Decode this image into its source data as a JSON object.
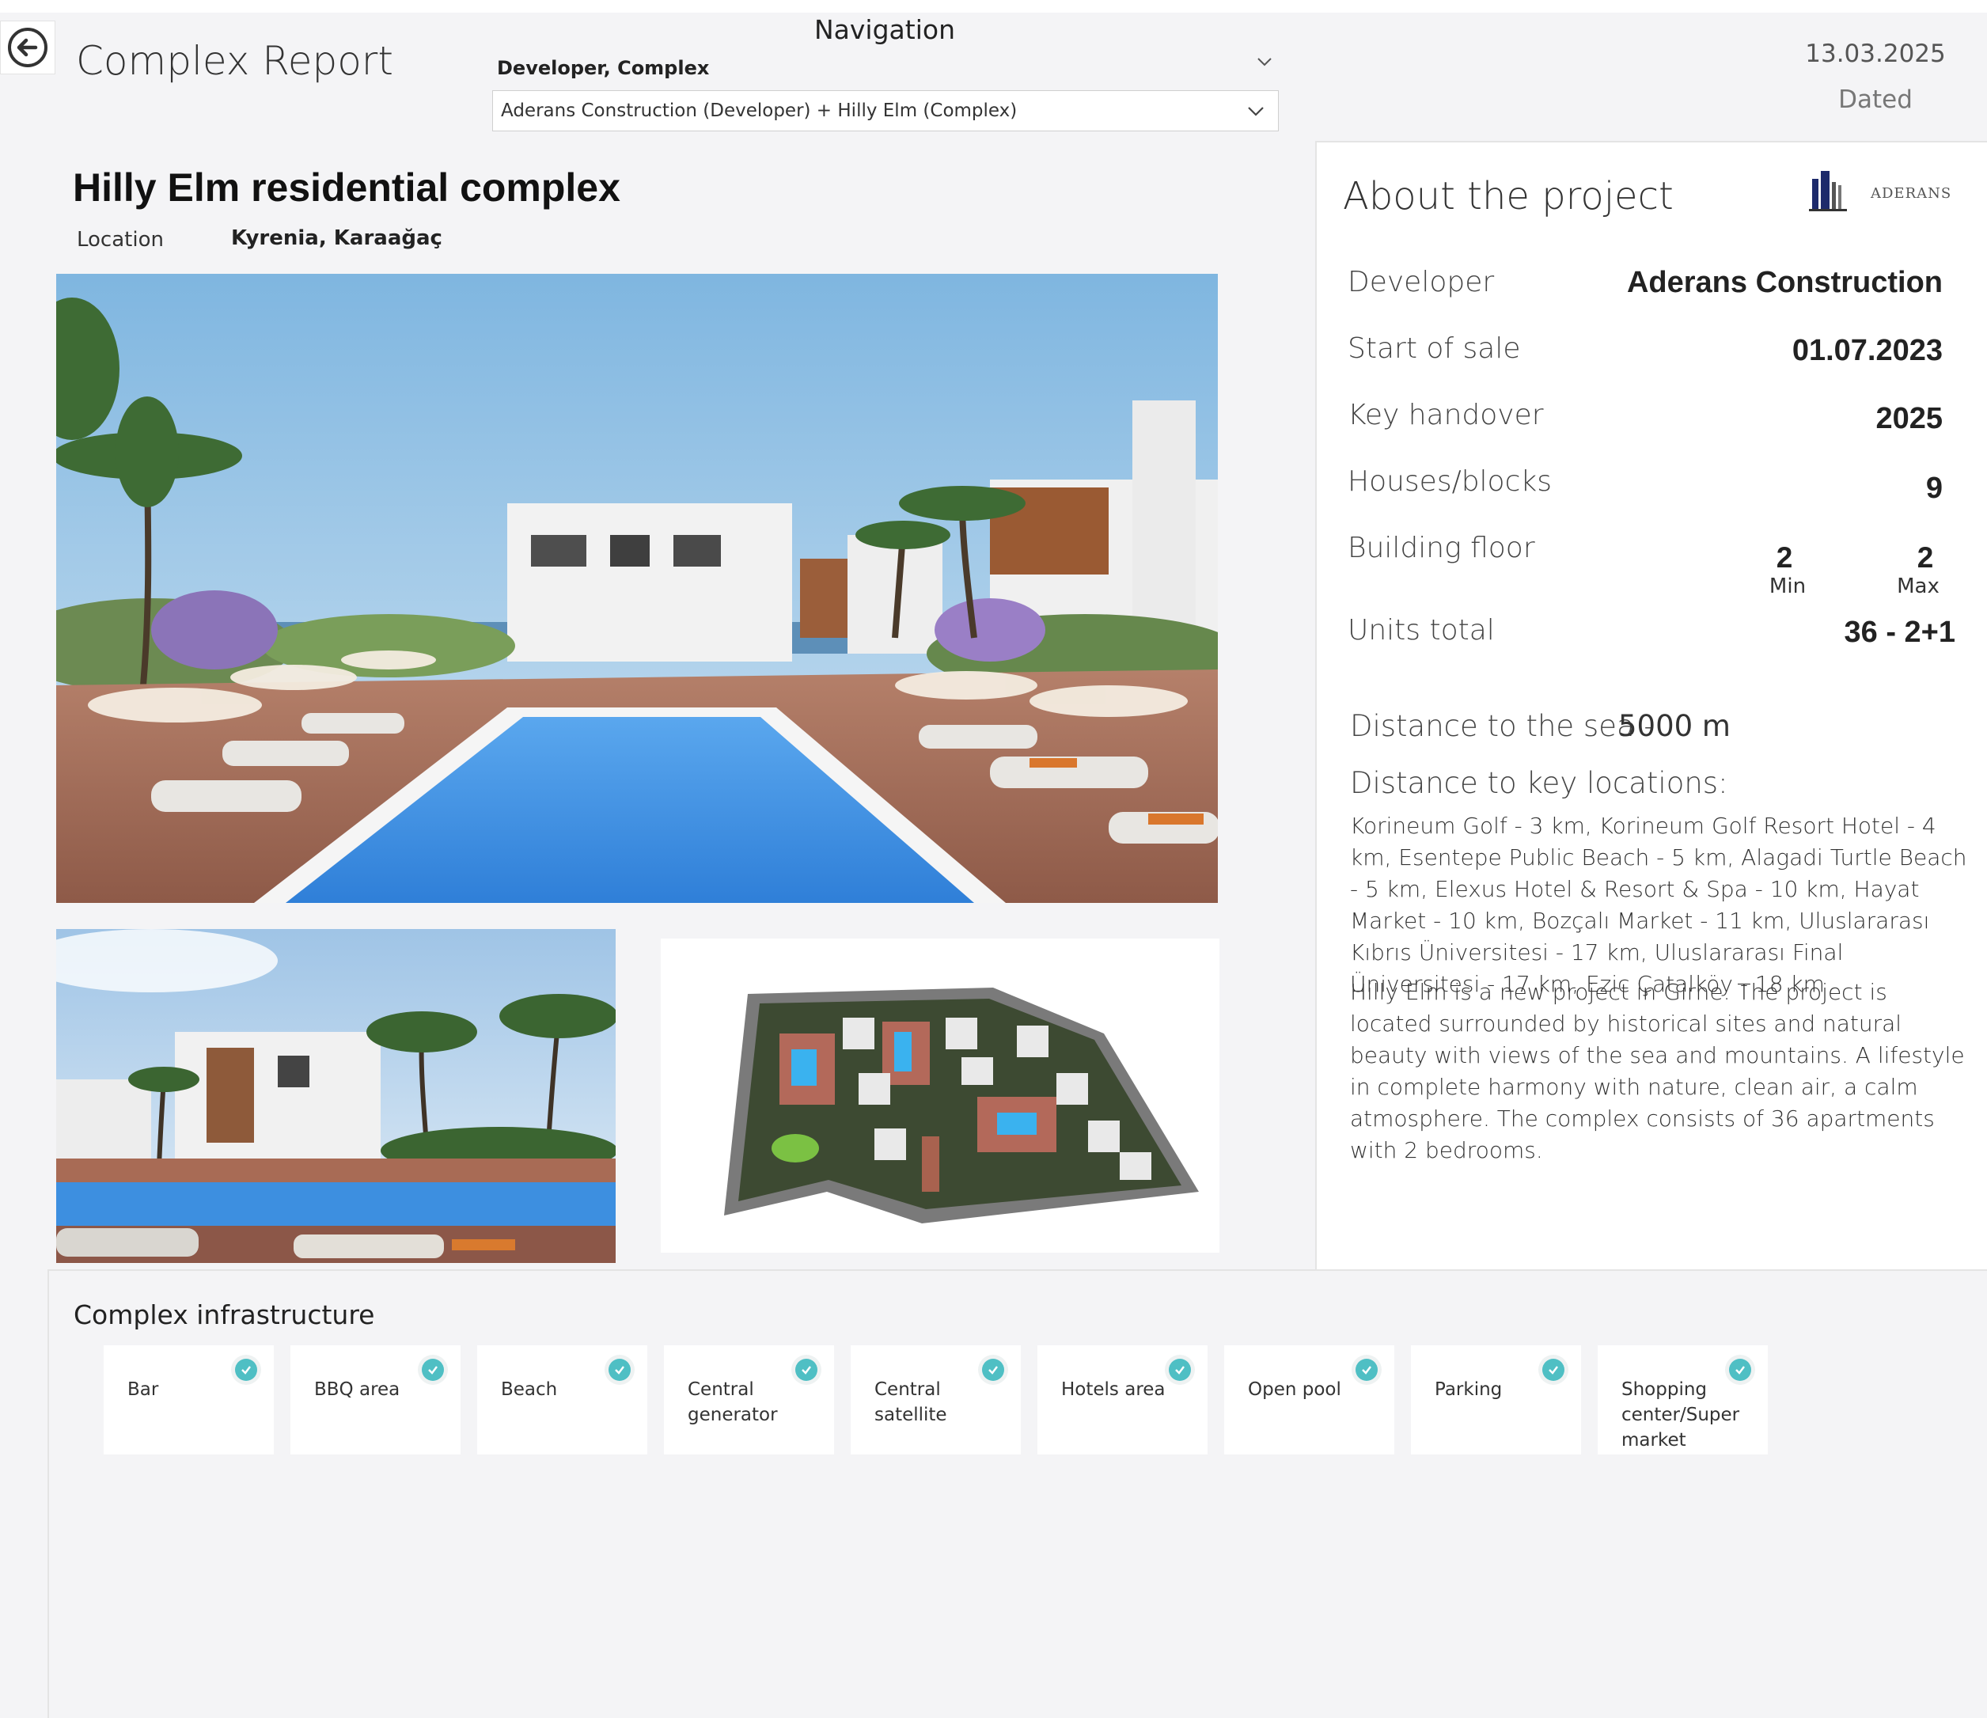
{
  "header": {
    "title": "Complex Report",
    "navigation": {
      "heading": "Navigation",
      "label": "Developer, Complex",
      "selected": "Aderans Construction (Developer) + Hilly Elm (Complex)"
    },
    "date": "13.03.2025",
    "date_label": "Dated"
  },
  "complex": {
    "name": "Hilly Elm residential complex",
    "location_label": "Location",
    "location_value": "Kyrenia, Karaağaç"
  },
  "about": {
    "title": "About the project",
    "logo_text": "ADERANS",
    "rows": {
      "developer": {
        "label": "Developer",
        "value": "Aderans Construction"
      },
      "start_of_sale": {
        "label": "Start of sale",
        "value": "01.07.2023"
      },
      "key_handover": {
        "label": "Key handover",
        "value": "2025"
      },
      "houses_blocks": {
        "label": "Houses/blocks",
        "value": "9"
      },
      "building_floor": {
        "label": "Building floor",
        "min_value": "2",
        "min_label": "Min",
        "max_value": "2",
        "max_label": "Max"
      },
      "units_total": {
        "label": "Units total",
        "value": "36 - 2+1"
      }
    },
    "distance_sea_label": "Distance to the sea -",
    "distance_sea_value": "5000 m",
    "key_locations_title": "Distance to key locations:",
    "key_locations_text": "Korineum Golf - 3 km, Korineum Golf Resort Hotel - 4 km, Esentepe Public Beach - 5 km, Alagadi Turtle Beach - 5 km, Elexus Hotel & Resort & Spa - 10 km, Hayat Market - 10 km, Bozçalı Market - 11 km, Uluslararası Kıbrıs Üniversitesi - 17 km, Uluslararası Final Üniversitesi - 17 km, Ezic Çatalköy - 18 km",
    "description": "Hilly Elm is a new project in Girne. The project is located surrounded by historical sites and natural beauty with views of the sea and mountains. A lifestyle in complete harmony with nature, clean air, a calm atmosphere. The complex consists of 36 apartments with 2 bedrooms."
  },
  "infrastructure": {
    "title": "Complex infrastructure",
    "items": [
      {
        "label": "Bar"
      },
      {
        "label": "BBQ area"
      },
      {
        "label": "Beach"
      },
      {
        "label": "Central generator"
      },
      {
        "label": "Central satellite"
      },
      {
        "label": "Hotels area"
      },
      {
        "label": "Open pool"
      },
      {
        "label": "Parking"
      },
      {
        "label": "Shopping center/Super market"
      }
    ]
  },
  "colors": {
    "accent_check": "#4fbfc4",
    "pool_blue": "#4a9fe6"
  }
}
